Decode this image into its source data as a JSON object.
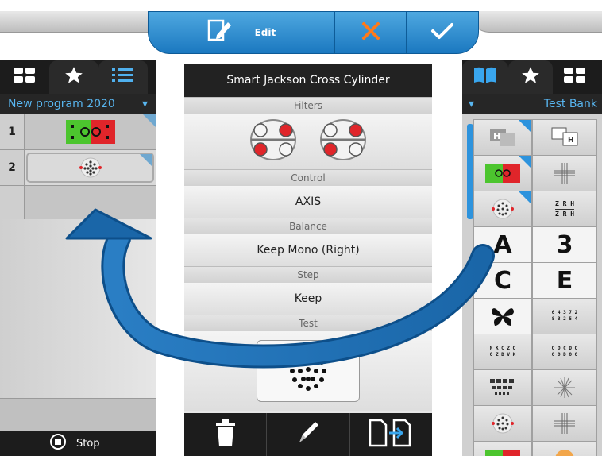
{
  "toolbar": {
    "edit_label": "Edit",
    "edit_icon": "edit-document-icon",
    "cancel_icon": "close-icon",
    "confirm_icon": "checkmark-icon"
  },
  "left_panel": {
    "tabs": [
      "grid-view-icon",
      "favorites-star-icon",
      "list-view-icon"
    ],
    "program_title": "New program 2020",
    "rows": [
      {
        "number": "1",
        "test": "red-green-test"
      },
      {
        "number": "2",
        "test": "cross-cylinder-dots-test"
      }
    ],
    "stop_label": "Stop"
  },
  "center_panel": {
    "title": "Smart Jackson Cross Cylinder",
    "filters_label": "Filters",
    "control_label": "Control",
    "control_value": "AXIS",
    "balance_label": "Balance",
    "balance_value": "Keep Mono (Right)",
    "step_label": "Step",
    "step_value": "Keep",
    "test_label": "Test",
    "bottom_buttons": [
      "trash-icon",
      "pencil-icon",
      "export-icon"
    ]
  },
  "right_panel": {
    "tabs": [
      "book-icon",
      "favorites-star-icon",
      "grid-view-icon"
    ],
    "title": "Test Bank",
    "letters": {
      "a": "A",
      "three": "3",
      "c": "C",
      "e": "E"
    },
    "snellen_rows": [
      "Z R H",
      "Z R H"
    ],
    "number_chart": [
      "6 4 3 7 2",
      "8 3 2 5 4"
    ],
    "letter_chart": [
      "N K C Z O",
      "O Z D V K"
    ],
    "ring_chart": [
      "O O C D O",
      "O O D O O"
    ]
  },
  "colors": {
    "accent_blue": "#1f82cc",
    "title_blue": "#58b5ef",
    "dark": "#1c1c1c",
    "red": "#e0252a",
    "green": "#4cc52e"
  }
}
